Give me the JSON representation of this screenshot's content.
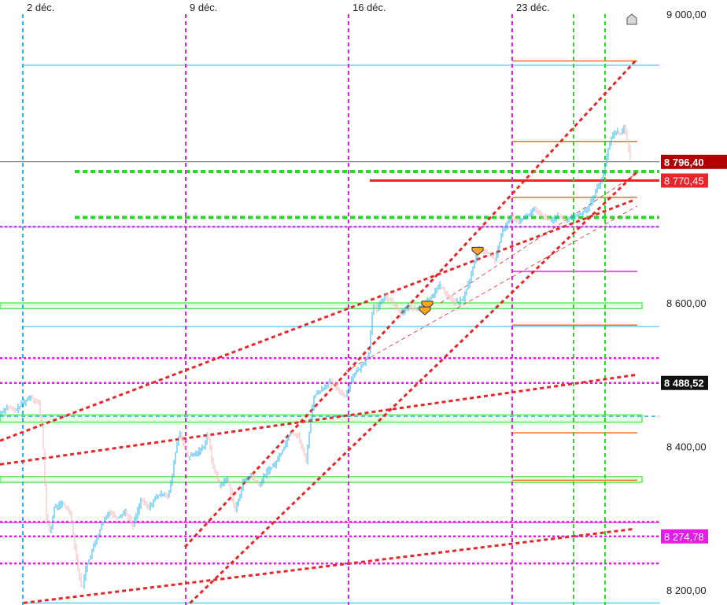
{
  "chart_data": {
    "type": "candlestick",
    "title": "",
    "xlabel": "",
    "ylabel": "",
    "ylim": [
      8180,
      9000
    ],
    "x_tick_labels": [
      "2 déc.",
      "9 déc.",
      "16 déc.",
      "23 déc."
    ],
    "y_tick_labels": [
      {
        "value": 9000,
        "label": "9 000,00"
      },
      {
        "value": 8600,
        "label": "8 600,00"
      },
      {
        "value": 8400,
        "label": "8 400,00"
      },
      {
        "value": 8200,
        "label": "8 200,00"
      }
    ],
    "price_tags": [
      {
        "value": 8796.4,
        "label": "8 796,40",
        "color": "#b00000",
        "kind": "last"
      },
      {
        "value": 8770.45,
        "label": "8 770,45",
        "color": "#e8262a",
        "kind": "level"
      },
      {
        "value": 8488.52,
        "label": "8 488,52",
        "color": "#111111",
        "kind": "level"
      },
      {
        "value": 8274.78,
        "label": "8 274,78",
        "color": "#e020e0",
        "kind": "level"
      }
    ],
    "price_path": [
      [
        0,
        8445
      ],
      [
        5,
        8450
      ],
      [
        10,
        8455
      ],
      [
        20,
        8450
      ],
      [
        30,
        8460
      ],
      [
        40,
        8470
      ],
      [
        50,
        8460
      ],
      [
        55,
        8420
      ],
      [
        60,
        8300
      ],
      [
        65,
        8280
      ],
      [
        70,
        8315
      ],
      [
        80,
        8320
      ],
      [
        90,
        8310
      ],
      [
        95,
        8270
      ],
      [
        100,
        8230
      ],
      [
        105,
        8200
      ],
      [
        110,
        8230
      ],
      [
        120,
        8260
      ],
      [
        130,
        8290
      ],
      [
        140,
        8310
      ],
      [
        150,
        8300
      ],
      [
        160,
        8310
      ],
      [
        170,
        8290
      ],
      [
        180,
        8325
      ],
      [
        190,
        8315
      ],
      [
        200,
        8330
      ],
      [
        210,
        8335
      ],
      [
        215,
        8330
      ],
      [
        220,
        8360
      ],
      [
        225,
        8400
      ],
      [
        230,
        8420
      ],
      [
        235,
        8400
      ],
      [
        240,
        8385
      ],
      [
        250,
        8390
      ],
      [
        260,
        8400
      ],
      [
        265,
        8420
      ],
      [
        270,
        8380
      ],
      [
        280,
        8345
      ],
      [
        290,
        8355
      ],
      [
        300,
        8310
      ],
      [
        310,
        8350
      ],
      [
        320,
        8360
      ],
      [
        330,
        8345
      ],
      [
        340,
        8365
      ],
      [
        350,
        8375
      ],
      [
        360,
        8395
      ],
      [
        370,
        8420
      ],
      [
        380,
        8415
      ],
      [
        390,
        8380
      ],
      [
        395,
        8430
      ],
      [
        400,
        8470
      ],
      [
        410,
        8480
      ],
      [
        420,
        8490
      ],
      [
        430,
        8480
      ],
      [
        440,
        8470
      ],
      [
        450,
        8500
      ],
      [
        460,
        8510
      ],
      [
        470,
        8530
      ],
      [
        475,
        8600
      ],
      [
        480,
        8590
      ],
      [
        490,
        8610
      ],
      [
        500,
        8600
      ],
      [
        510,
        8585
      ],
      [
        520,
        8595
      ],
      [
        530,
        8590
      ],
      [
        540,
        8600
      ],
      [
        550,
        8610
      ],
      [
        560,
        8625
      ],
      [
        570,
        8610
      ],
      [
        580,
        8600
      ],
      [
        590,
        8605
      ],
      [
        600,
        8640
      ],
      [
        605,
        8660
      ],
      [
        610,
        8675
      ],
      [
        620,
        8670
      ],
      [
        630,
        8660
      ],
      [
        640,
        8700
      ],
      [
        650,
        8720
      ],
      [
        660,
        8715
      ],
      [
        670,
        8720
      ],
      [
        680,
        8730
      ],
      [
        690,
        8720
      ],
      [
        700,
        8715
      ],
      [
        710,
        8720
      ],
      [
        720,
        8715
      ],
      [
        730,
        8720
      ],
      [
        740,
        8725
      ],
      [
        750,
        8735
      ],
      [
        760,
        8760
      ],
      [
        765,
        8770
      ],
      [
        770,
        8790
      ],
      [
        775,
        8820
      ],
      [
        780,
        8835
      ],
      [
        785,
        8840
      ],
      [
        790,
        8835
      ],
      [
        795,
        8845
      ],
      [
        800,
        8815
      ],
      [
        803,
        8798
      ]
    ],
    "horizontal_levels": [
      {
        "value": 8931,
        "color": "#29b6e8",
        "style": "solid"
      },
      {
        "value": 8937,
        "color": "#ff6a2a",
        "style": "solid",
        "partial": true
      },
      {
        "value": 8825,
        "color": "#ff6a2a",
        "style": "solid",
        "partial": true
      },
      {
        "value": 8783,
        "color": "#22dd22",
        "style": "dashed-thick"
      },
      {
        "value": 8770.45,
        "color": "#e8262a",
        "style": "solid-thick",
        "partial": true
      },
      {
        "value": 8747,
        "color": "#ff6a2a",
        "style": "solid",
        "partial": true
      },
      {
        "value": 8719,
        "color": "#22dd22",
        "style": "dashed-thick"
      },
      {
        "value": 8706,
        "color": "#e020e0",
        "style": "dotted"
      },
      {
        "value": 8706,
        "color": "#9a7cff",
        "style": "solid"
      },
      {
        "value": 8644,
        "color": "#e020e0",
        "style": "solid",
        "partial": true
      },
      {
        "value": 8567,
        "color": "#29b6e8",
        "style": "solid"
      },
      {
        "value": 8569,
        "color": "#ff6a2a",
        "style": "solid",
        "partial": true
      },
      {
        "value": 8523,
        "color": "#e020e0",
        "style": "dotted"
      },
      {
        "value": 8488.52,
        "color": "#e020e0",
        "style": "dotted"
      },
      {
        "value": 8442,
        "color": "#29b6e8",
        "style": "dashed"
      },
      {
        "value": 8419,
        "color": "#ff6a2a",
        "style": "solid",
        "partial": true
      },
      {
        "value": 8353,
        "color": "#ff6a2a",
        "style": "solid",
        "partial": true
      },
      {
        "value": 8294,
        "color": "#e020e0",
        "style": "solid"
      },
      {
        "value": 8295,
        "color": "#e020e0",
        "style": "dotted"
      },
      {
        "value": 8274.78,
        "color": "#e020e0",
        "style": "dotted"
      },
      {
        "value": 8237,
        "color": "#e020e0",
        "style": "dotted"
      },
      {
        "value": 8182,
        "color": "#29b6e8",
        "style": "solid"
      }
    ],
    "zones": [
      {
        "low": 8592,
        "high": 8600,
        "color": "#22dd22"
      },
      {
        "low": 8434,
        "high": 8444,
        "color": "#22dd22"
      },
      {
        "low": 8350,
        "high": 8358,
        "color": "#22dd22"
      }
    ],
    "vertical_lines": [
      {
        "label_index": 0,
        "color": "#29b6e8"
      },
      {
        "label_index": 1,
        "color": "#e020e0"
      },
      {
        "label_index": 2,
        "color": "#e020e0"
      },
      {
        "label_index": 3,
        "color": "#e020e0"
      },
      {
        "label_index": null,
        "color": "#22dd22"
      },
      {
        "label_index": null,
        "color": "#22dd22"
      }
    ],
    "trend_lines": [
      {
        "from": [
          0,
          8408
        ],
        "to": [
          805,
          8743
        ],
        "color": "#e8262a"
      },
      {
        "from": [
          0,
          8375
        ],
        "to": [
          810,
          8500
        ],
        "color": "#e8262a"
      },
      {
        "from": [
          30,
          8182
        ],
        "to": [
          805,
          8285
        ],
        "color": "#e8262a"
      },
      {
        "from": [
          235,
          8260
        ],
        "to": [
          810,
          8940
        ],
        "color": "#e8262a"
      },
      {
        "from": [
          235,
          8175
        ],
        "to": [
          810,
          8783
        ],
        "color": "#e8262a"
      },
      {
        "from": [
          440,
          8505
        ],
        "to": [
          810,
          8735
        ],
        "color": "#e8262a",
        "thin": true
      },
      {
        "from": [
          560,
          8600
        ],
        "to": [
          810,
          8781
        ],
        "color": "#e8262a",
        "thin": true
      }
    ],
    "markers": [
      {
        "x": 543,
        "value": 8598,
        "color": "#f5a623"
      },
      {
        "x": 540,
        "value": 8590,
        "color": "#f5a623"
      },
      {
        "x": 607,
        "value": 8673,
        "color": "#f5a623"
      }
    ]
  }
}
